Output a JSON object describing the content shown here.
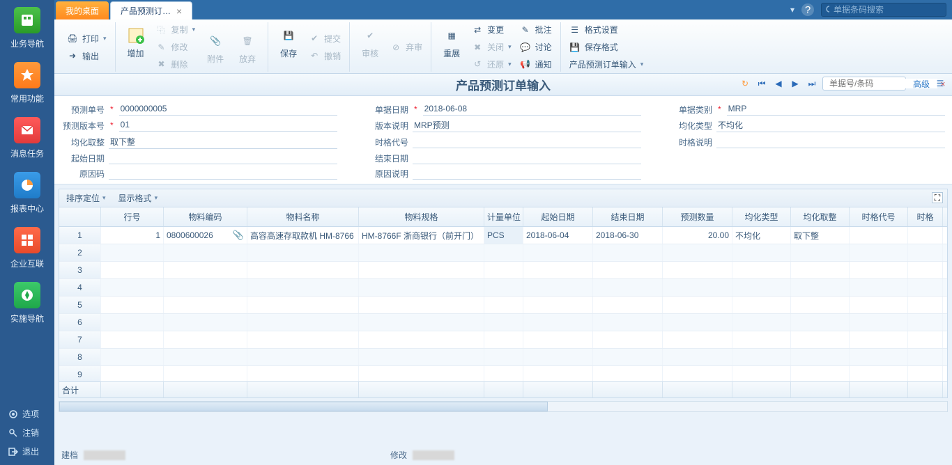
{
  "rail": {
    "items": [
      "业务导航",
      "常用功能",
      "消息任务",
      "报表中心",
      "企业互联",
      "实施导航"
    ],
    "footer": [
      "选项",
      "注销",
      "退出"
    ]
  },
  "tabs": {
    "desktop": "我的桌面",
    "active": "产品预测订…"
  },
  "top_search_placeholder": "单据条码搜索",
  "ribbon": {
    "print": "打印",
    "export": "输出",
    "add": "增加",
    "copy": "复制",
    "modify": "修改",
    "delete": "删除",
    "attach": "附件",
    "discard": "放弃",
    "save": "保存",
    "submit": "提交",
    "revoke": "撤销",
    "audit": "审核",
    "abandon": "弃审",
    "redisplay": "重展",
    "change": "变更",
    "close": "关闭",
    "return": "还原",
    "annotate": "批注",
    "discuss": "讨论",
    "notify": "通知",
    "format_set": "格式设置",
    "save_format": "保存格式",
    "import_link": "产品预测订单输入"
  },
  "page_title": "产品预测订单输入",
  "nav_placeholder": "单据号/条码",
  "adv": "高级",
  "form": {
    "order_no_l": "预测单号",
    "order_no": "0000000005",
    "bill_date_l": "单据日期",
    "bill_date": "2018-06-08",
    "bill_type_l": "单据类别",
    "bill_type": "MRP",
    "version_l": "预测版本号",
    "version": "01",
    "ver_desc_l": "版本说明",
    "ver_desc": "MRP预测",
    "uniform_l": "均化类型",
    "uniform": "不均化",
    "round_l": "均化取整",
    "round": "取下整",
    "timecode_l": "时格代号",
    "timedesc_l": "时格说明",
    "start_l": "起始日期",
    "end_l": "结束日期",
    "reason_l": "原因码",
    "reason_desc_l": "原因说明"
  },
  "toolbar": {
    "sort": "排序定位",
    "display": "显示格式"
  },
  "grid": {
    "headers": [
      "行号",
      "物料编码",
      "物料名称",
      "物料规格",
      "计量单位",
      "起始日期",
      "结束日期",
      "预测数量",
      "均化类型",
      "均化取整",
      "时格代号",
      "时格"
    ],
    "row1": {
      "n": "1",
      "ln": "1",
      "code": "0800600026",
      "name": "高容高速存取款机 HM-8766",
      "spec": "HM-8766F 浙商银行（前开门）",
      "unit": "PCS",
      "start": "2018-06-04",
      "end": "2018-06-30",
      "qty": "20.00",
      "uniform": "不均化",
      "round": "取下整"
    },
    "sum": "合计"
  },
  "footer": {
    "create": "建档",
    "modify": "修改"
  }
}
